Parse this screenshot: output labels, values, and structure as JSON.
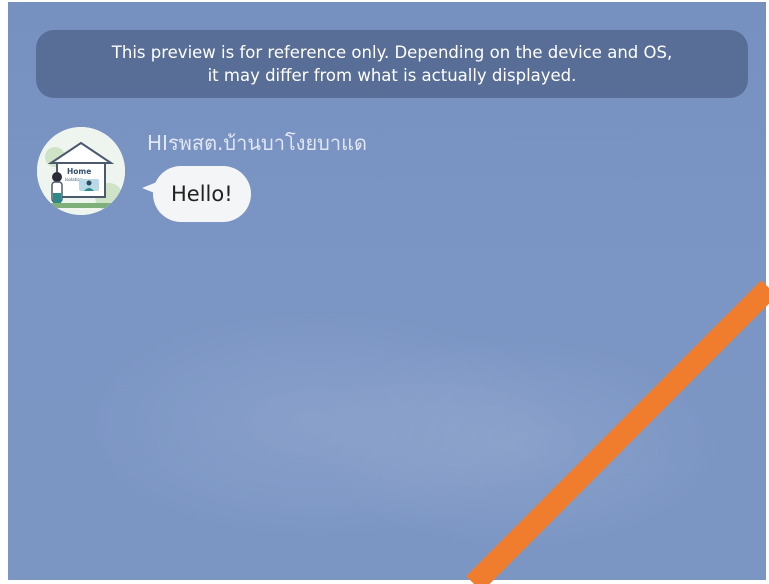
{
  "preview_notice": {
    "line1": "This preview is for reference only. Depending on the device and OS,",
    "line2": "it may differ from what is actually displayed."
  },
  "message": {
    "sender_name": "HIรพสต.บ้านบาโงยบาแด",
    "text": "Hello!",
    "avatar": {
      "label_main": "Home",
      "label_sub": "Isolation"
    }
  },
  "colors": {
    "background": "#7a94c3",
    "notice_bg": "#4c5c80",
    "bubble_bg": "#f4f5f6",
    "stripe": "#ef7d2d"
  }
}
